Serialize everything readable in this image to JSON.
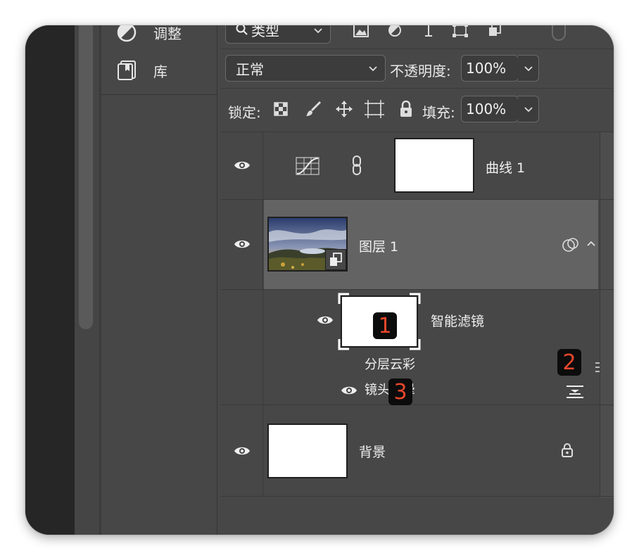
{
  "left_panel": {
    "items": [
      {
        "label": "调整",
        "icon": "adjustments-icon"
      },
      {
        "label": "库",
        "icon": "library-icon"
      }
    ]
  },
  "filter_row": {
    "search_label": "类型"
  },
  "blend_row": {
    "blend_mode": "正常",
    "opacity_label": "不透明度:",
    "opacity_value": "100%"
  },
  "lock_row": {
    "lock_label": "锁定:",
    "fill_label": "填充:",
    "fill_value": "100%"
  },
  "layers": [
    {
      "name": "曲线 1",
      "type": "adjustment"
    },
    {
      "name": "图层 1",
      "type": "smart-object"
    },
    {
      "name": "智能滤镜",
      "type": "smart-filter-mask"
    },
    {
      "name": "分层云彩",
      "type": "filter"
    },
    {
      "name": "镜头光晕",
      "type": "filter"
    },
    {
      "name": "背景",
      "type": "background"
    }
  ],
  "callouts": [
    "1",
    "2",
    "3"
  ],
  "colors": {
    "panel_bg": "#474747",
    "selected_layer": "#636363",
    "callout_text": "#e8472c",
    "callout_bg": "#0c0c0c"
  }
}
